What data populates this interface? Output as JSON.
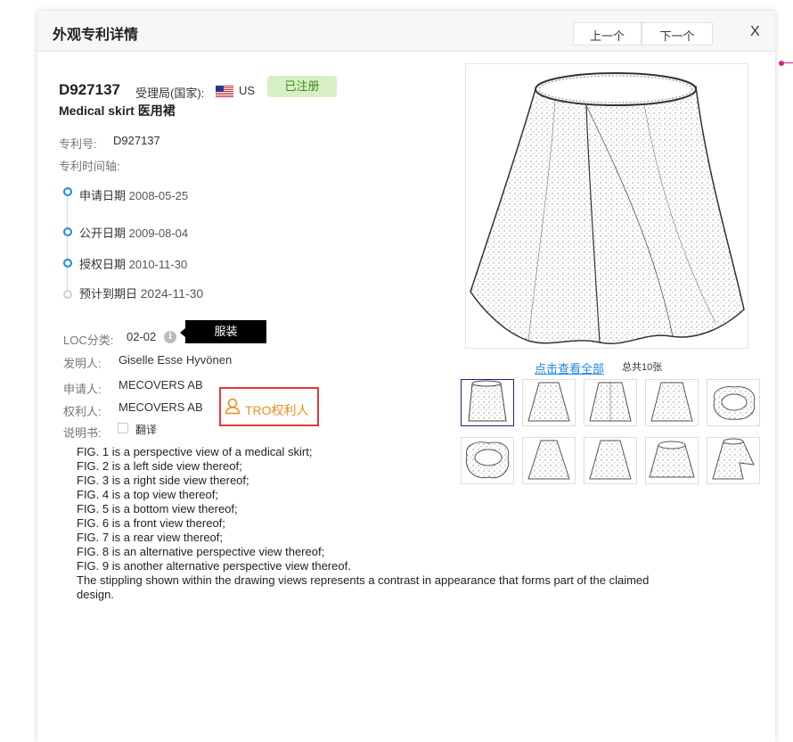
{
  "modal": {
    "title": "外观专利详情",
    "prev_label": "上一个",
    "next_label": "下一个",
    "close_label": "X"
  },
  "patent": {
    "id": "D927137",
    "office_label": "受理局(国家):",
    "country": "US",
    "flag_icon": "us-flag-icon",
    "status": "已注册",
    "title": "Medical skirt 医用裙"
  },
  "fields": {
    "patent_no_label": "专利号:",
    "patent_no": "D927137",
    "timeline_label": "专利时间轴:",
    "loc_label": "LOC分类:",
    "loc_value": "02-02",
    "loc_tooltip": "服装",
    "inventor_label": "发明人:",
    "inventor": "Giselle Esse Hyvönen",
    "applicant_label": "申请人:",
    "applicant": "MECOVERS AB",
    "owner_label": "权利人:",
    "owner": "MECOVERS AB",
    "tro_label": "TRO权利人",
    "spec_label": "说明书:",
    "translate_label": "翻译"
  },
  "timeline": [
    {
      "label": "申请日期",
      "date": "2008-05-25"
    },
    {
      "label": "公开日期",
      "date": "2009-08-04"
    },
    {
      "label": "授权日期",
      "date": "2010-11-30"
    },
    {
      "label": "预计到期日",
      "date": "2024-11-30"
    }
  ],
  "description": [
    "FIG. 1 is a perspective view of a medical skirt;",
    "FIG. 2 is a left side view thereof;",
    "FIG. 3 is a right side view thereof;",
    "FIG. 4 is a top view thereof;",
    "FIG. 5 is a bottom view thereof;",
    "FIG. 6 is a front view thereof;",
    "FIG. 7 is a rear view thereof;",
    "FIG. 8 is an alternative perspective view thereof;",
    "FIG. 9 is another alternative perspective view thereof.",
    "The stippling shown within the drawing views represents a contrast in appearance that forms part of the claimed design."
  ],
  "gallery": {
    "view_all": "点击查看全部",
    "total": "总共10张",
    "thumbnails": [
      "skirt-perspective",
      "skirt-left",
      "skirt-right",
      "skirt-front",
      "skirt-top",
      "skirt-bottom",
      "skirt-rear",
      "skirt-alt",
      "skirt-open",
      "skirt-alt-2"
    ]
  },
  "colors": {
    "accent": "#1e88e5",
    "status_bg": "#d8efc6",
    "status_text": "#3b8d1a",
    "tro_border": "#e53935",
    "tro_text": "#f08c1c"
  }
}
